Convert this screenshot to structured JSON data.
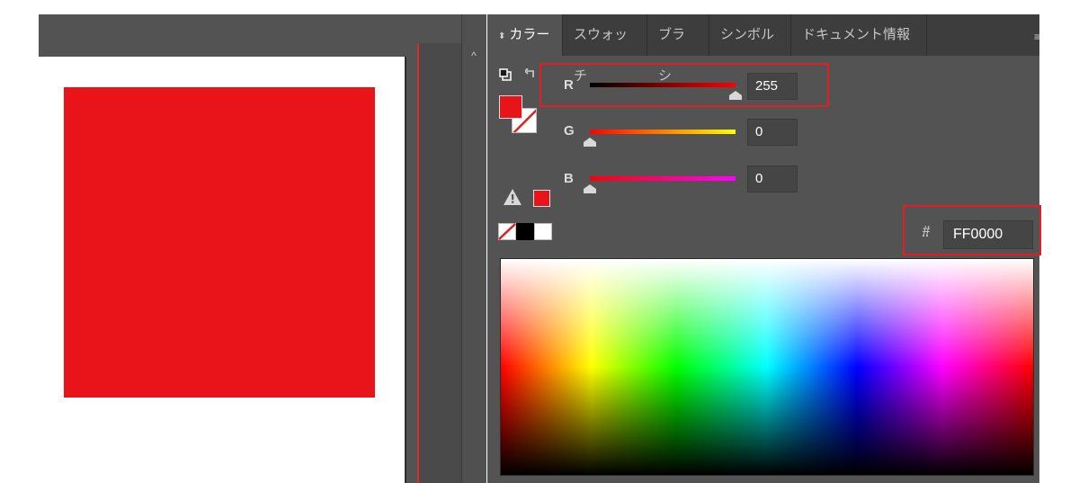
{
  "tabs": [
    {
      "label": "カラー",
      "active": true
    },
    {
      "label": "スウォッチ",
      "active": false
    },
    {
      "label": "ブラシ",
      "active": false
    },
    {
      "label": "シンボル",
      "active": false
    },
    {
      "label": "ドキュメント情報",
      "active": false
    }
  ],
  "channels": {
    "r": {
      "label": "R",
      "value": "255",
      "fraction": 1.0
    },
    "g": {
      "label": "G",
      "value": "0",
      "fraction": 0.0
    },
    "b": {
      "label": "B",
      "value": "0",
      "fraction": 0.0
    }
  },
  "hex": {
    "symbol": "#",
    "value": "FF0000"
  },
  "colors": {
    "fill": "#e8141a",
    "artwork": "#e8141a",
    "guide": "#d32f2f",
    "highlight": "#e02020"
  },
  "icons": {
    "tab_collapse": "double-arrow-icon",
    "default_colors": "default-fill-stroke-icon",
    "swap": "swap-fill-stroke-icon",
    "out_of_gamut": "warning-icon",
    "none": "none-swatch-icon",
    "black": "black-swatch-icon",
    "white": "white-swatch-icon",
    "panel_menu": "panel-menu-icon",
    "scroll_up": "chevron-up-icon"
  }
}
